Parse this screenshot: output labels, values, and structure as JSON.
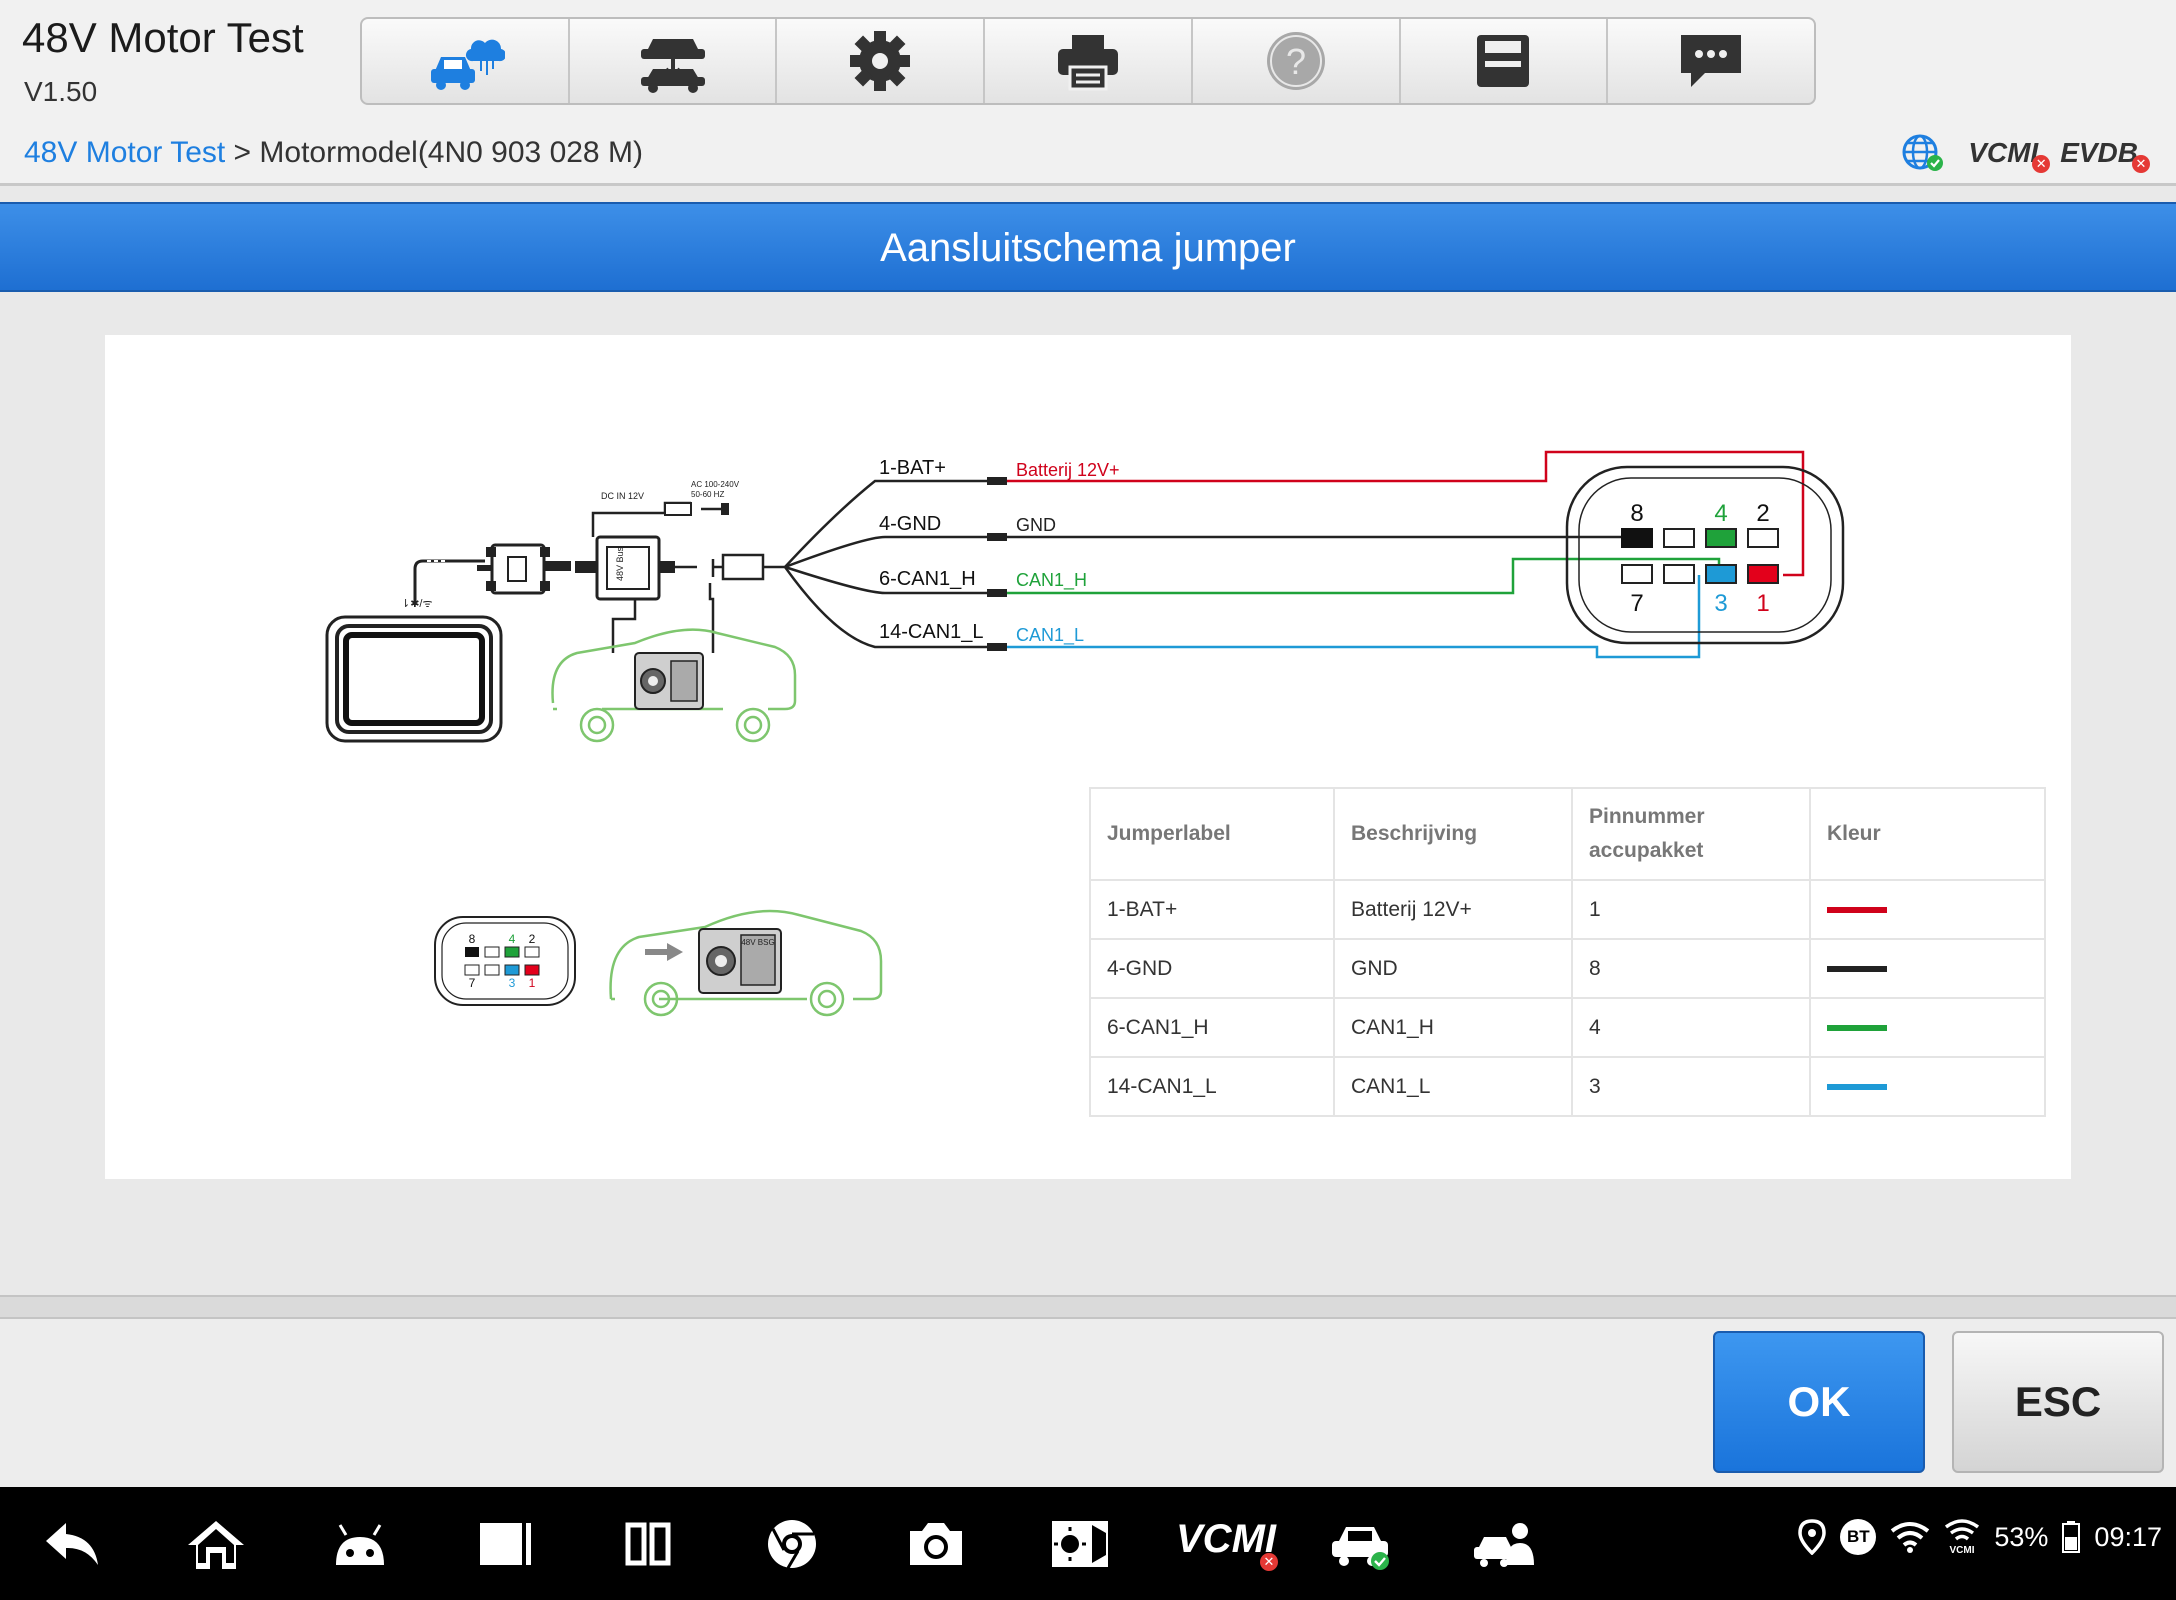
{
  "app": {
    "title": "48V Motor Test",
    "version": "V1.50"
  },
  "toolbar": {
    "buttons": [
      {
        "icon": "vehicle-cloud-icon",
        "active": true
      },
      {
        "icon": "vehicle-lift-icon"
      },
      {
        "icon": "gear-icon"
      },
      {
        "icon": "printer-icon"
      },
      {
        "icon": "help-icon"
      },
      {
        "icon": "save-icon"
      },
      {
        "icon": "chat-icon"
      }
    ]
  },
  "breadcrumb": {
    "root": "48V Motor Test",
    "separator": " > ",
    "current": "Motormodel(4N0 903 028 M)"
  },
  "status": {
    "vcm": "VCMI",
    "evdb": "EVDB"
  },
  "dialog": {
    "title": "Aansluitschema jumper"
  },
  "diagram": {
    "wires": [
      {
        "left_label": "1-BAT+",
        "right_label": "Batterij 12V+",
        "color": "#d0021b"
      },
      {
        "left_label": "4-GND",
        "right_label": "GND",
        "color": "#222222"
      },
      {
        "left_label": "6-CAN1_H",
        "right_label": "CAN1_H",
        "color": "#1fa23a"
      },
      {
        "left_label": "14-CAN1_L",
        "right_label": "CAN1_L",
        "color": "#1e9ad6"
      }
    ],
    "connector_pins": {
      "p8": "8",
      "p4": "4",
      "p2": "2",
      "p7": "7",
      "p3": "3",
      "p1": "1"
    },
    "box_dc": "DC IN 12V",
    "box_ac_1": "AC 100-240V",
    "box_ac_2": "50-60 HZ",
    "engine_label": "48V BSG"
  },
  "table": {
    "headers": [
      "Jumperlabel",
      "Beschrijving",
      "Pinnummer accupakket",
      "Kleur"
    ],
    "rows": [
      {
        "label": "1-BAT+",
        "description": "Batterij 12V+",
        "pin": "1",
        "color": "#d0021b"
      },
      {
        "label": "4-GND",
        "description": "GND",
        "pin": "8",
        "color": "#222222"
      },
      {
        "label": "6-CAN1_H",
        "description": "CAN1_H",
        "pin": "4",
        "color": "#1fa23a"
      },
      {
        "label": "14-CAN1_L",
        "description": "CAN1_L",
        "pin": "3",
        "color": "#1e9ad6"
      }
    ]
  },
  "buttons": {
    "ok": "OK",
    "esc": "ESC"
  },
  "navbar": {
    "icons": [
      "back-icon",
      "home-icon",
      "android-icon",
      "recent-apps-icon",
      "split-screen-icon",
      "chrome-icon",
      "camera-icon",
      "brightness-icon",
      "vcmi-icon",
      "vehicle-connected-icon",
      "remote-expert-icon"
    ],
    "vcmi_label": "VCMI",
    "bt": "BT",
    "battery": "53%",
    "time": "09:17"
  }
}
